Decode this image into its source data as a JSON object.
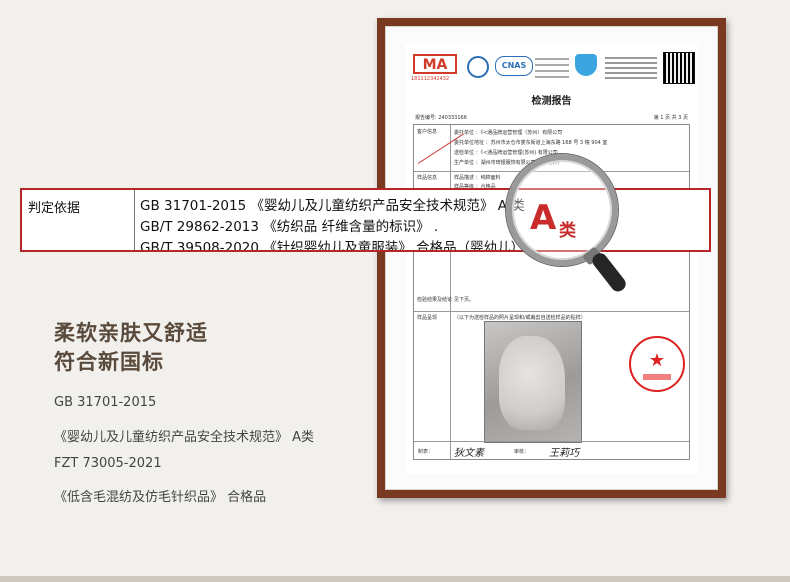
{
  "heading": {
    "line1": "柔软亲肤又舒适",
    "line2": "符合新国标"
  },
  "standards": [
    "GB 31701-2015",
    "《婴幼儿及儿童纺织产品安全技术规范》 A类",
    "FZT 73005-2021",
    "《低含毛混纺及仿毛针织品》 合格品"
  ],
  "highlight": {
    "label": "判定依据",
    "lines": [
      "GB 31701-2015 《婴幼儿及儿童纺织产品安全技术规范》 A 类",
      "GB/T 29862-2013 《纺织品 纤维含量的标识》 .",
      "GB/T 39508-2020 《针织婴幼儿及童服装》 合格品（婴幼儿）"
    ]
  },
  "magnifier": {
    "grade_letter": "A",
    "grade_suffix": "类"
  },
  "report": {
    "cma_label": "MA",
    "cma_number": "181112342432",
    "cnas_label": "CNAS",
    "title": "检测报告",
    "report_no": "报告编号: 240333166",
    "page": "第 1 页 共 3 页",
    "rows": [
      {
        "label": "客户信息",
        "lines": [
          "委托单位 ：《<通品牌运营管理（苏州）有限公司",
          "委托单位地址 ：苏州市太仓市娄东街道上海东路 168 号 3 幢 904 室",
          "送检单位 ：《<通品牌运营管理(苏州) 有限公司",
          "生产单位 ：湖州市琦银服饰有限公司(梧威毛衫)"
        ]
      },
      {
        "label": "样品信息",
        "lines": [
          "样品描述 ：纯棉面料",
          "样品等级 ：合格品"
        ]
      },
      {
        "label": "检验结果及结论",
        "lines": [
          "见下页。"
        ]
      },
      {
        "label": "样品呈现",
        "lines": [
          "（以下为送检样品的照片呈现和/或裁剪自送检样品的贴样）"
        ]
      }
    ],
    "sign_labels": [
      "制表：",
      "审核："
    ],
    "signatures": [
      "狄文素",
      "王莉巧"
    ]
  }
}
